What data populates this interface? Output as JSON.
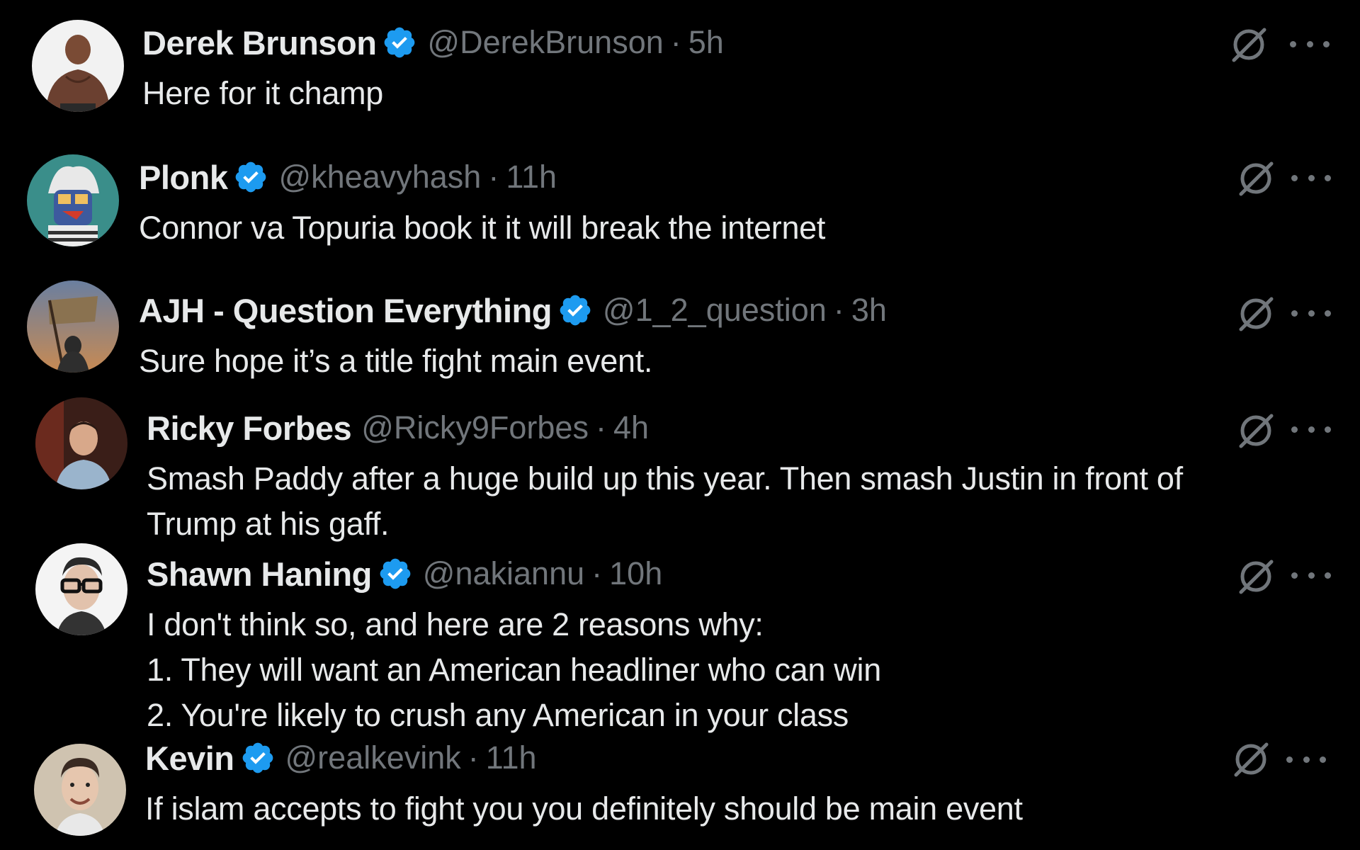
{
  "replies": [
    {
      "name": "Derek Brunson",
      "verified": true,
      "handle": "@DerekBrunson",
      "time": "5h",
      "lines": [
        "Here for it champ"
      ],
      "avatar_icon": "shirtless-fighter-avatar"
    },
    {
      "name": "Plonk",
      "verified": true,
      "handle": "@kheavyhash",
      "time": "11h",
      "lines": [
        "Connor va Topuria book it it will break the internet"
      ],
      "avatar_icon": "cartoon-character-avatar"
    },
    {
      "name": "AJH - Question Everything",
      "verified": true,
      "handle": "@1_2_question",
      "time": "3h",
      "lines": [
        "Sure hope it’s a title fight main event."
      ],
      "avatar_icon": "flag-bearer-avatar"
    },
    {
      "name": "Ricky Forbes",
      "verified": false,
      "handle": "@Ricky9Forbes",
      "time": "4h",
      "lines": [
        "Smash Paddy after a huge build up this year. Then smash Justin in front of",
        "Trump at his gaff."
      ],
      "avatar_icon": "man-photo-avatar"
    },
    {
      "name": "Shawn Haning",
      "verified": true,
      "handle": "@nakiannu",
      "time": "10h",
      "lines": [
        "I don't think so, and here are 2 reasons why:",
        "1. They will want an American headliner who can win",
        "2. You're likely to crush any American in your class"
      ],
      "avatar_icon": "man-with-glasses-avatar"
    },
    {
      "name": "Kevin",
      "verified": true,
      "handle": "@realkevink",
      "time": "11h",
      "lines": [
        "If islam accepts to fight you you definitely should be main event"
      ],
      "avatar_icon": "smiling-man-avatar"
    }
  ],
  "separator": "·",
  "icons": {
    "verified": "verified-badge-icon",
    "grok": "grok-icon",
    "more": "more-options-icon"
  },
  "colors": {
    "background": "#000000",
    "text": "#e7e9ea",
    "muted": "#71767b",
    "verified": "#1d9bf0"
  }
}
